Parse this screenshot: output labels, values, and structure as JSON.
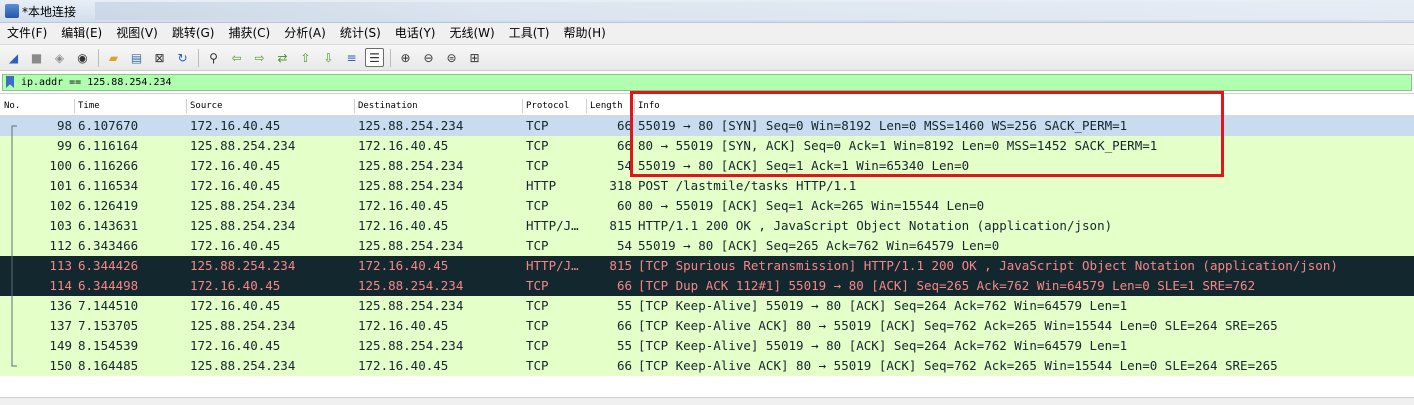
{
  "window": {
    "title": "*本地连接"
  },
  "menu": [
    "文件(F)",
    "编辑(E)",
    "视图(V)",
    "跳转(G)",
    "捕获(C)",
    "分析(A)",
    "统计(S)",
    "电话(Y)",
    "无线(W)",
    "工具(T)",
    "帮助(H)"
  ],
  "toolbar": {
    "buttons": [
      {
        "icon": "shark-fin-start-icon",
        "glyph": "◢",
        "color": "#2b5fb8"
      },
      {
        "icon": "stop-capture-icon",
        "glyph": "■",
        "color": "#8a8a8a"
      },
      {
        "icon": "restart-capture-icon",
        "glyph": "◈",
        "color": "#8a8a8a"
      },
      {
        "icon": "capture-options-icon",
        "glyph": "◉",
        "color": "#333333"
      },
      {
        "sep": true
      },
      {
        "icon": "open-file-icon",
        "glyph": "▰",
        "color": "#d7a52b"
      },
      {
        "icon": "save-file-icon",
        "glyph": "▤",
        "color": "#3a6ea5"
      },
      {
        "icon": "close-file-icon",
        "glyph": "⊠",
        "color": "#333333"
      },
      {
        "icon": "reload-file-icon",
        "glyph": "↻",
        "color": "#2b5fb8"
      },
      {
        "sep": true
      },
      {
        "icon": "find-packet-icon",
        "glyph": "⚲",
        "color": "#333333"
      },
      {
        "icon": "go-back-icon",
        "glyph": "⇦",
        "color": "#4e9a2a"
      },
      {
        "icon": "go-forward-icon",
        "glyph": "⇨",
        "color": "#4e9a2a"
      },
      {
        "icon": "go-to-packet-icon",
        "glyph": "⇄",
        "color": "#4e9a2a"
      },
      {
        "icon": "first-packet-icon",
        "glyph": "⇧",
        "color": "#4e9a2a"
      },
      {
        "icon": "last-packet-icon",
        "glyph": "⇩",
        "color": "#4e9a2a"
      },
      {
        "icon": "auto-scroll-icon",
        "glyph": "≡",
        "color": "#2b5fb8"
      },
      {
        "icon": "colorize-icon",
        "glyph": "☰",
        "color": "#333333",
        "selected": true
      },
      {
        "sep": true
      },
      {
        "icon": "zoom-in-icon",
        "glyph": "⊕",
        "color": "#333333"
      },
      {
        "icon": "zoom-out-icon",
        "glyph": "⊖",
        "color": "#333333"
      },
      {
        "icon": "normal-size-icon",
        "glyph": "⊜",
        "color": "#333333"
      },
      {
        "icon": "resize-columns-icon",
        "glyph": "⊞",
        "color": "#333333"
      }
    ]
  },
  "filter": {
    "value": "ip.addr == 125.88.254.234"
  },
  "columns": {
    "no": "No.",
    "time": "Time",
    "source": "Source",
    "destination": "Destination",
    "protocol": "Protocol",
    "length": "Length",
    "info": "Info"
  },
  "packets": [
    {
      "no": "98",
      "time": "6.107670",
      "source": "172.16.40.45",
      "destination": "125.88.254.234",
      "protocol": "TCP",
      "length": "66",
      "info": "55019 → 80 [SYN] Seq=0 Win=8192 Len=0 MSS=1460 WS=256 SACK_PERM=1",
      "style": "selected"
    },
    {
      "no": "99",
      "time": "6.116164",
      "source": "125.88.254.234",
      "destination": "172.16.40.45",
      "protocol": "TCP",
      "length": "66",
      "info": "80 → 55019 [SYN, ACK] Seq=0 Ack=1 Win=8192 Len=0 MSS=1452 SACK_PERM=1",
      "style": "normal"
    },
    {
      "no": "100",
      "time": "6.116266",
      "source": "172.16.40.45",
      "destination": "125.88.254.234",
      "protocol": "TCP",
      "length": "54",
      "info": "55019 → 80 [ACK] Seq=1 Ack=1 Win=65340 Len=0",
      "style": "normal"
    },
    {
      "no": "101",
      "time": "6.116534",
      "source": "172.16.40.45",
      "destination": "125.88.254.234",
      "protocol": "HTTP",
      "length": "318",
      "info": "POST /lastmile/tasks HTTP/1.1",
      "style": "normal"
    },
    {
      "no": "102",
      "time": "6.126419",
      "source": "125.88.254.234",
      "destination": "172.16.40.45",
      "protocol": "TCP",
      "length": "60",
      "info": "80 → 55019 [ACK] Seq=1 Ack=265 Win=15544 Len=0",
      "style": "normal"
    },
    {
      "no": "103",
      "time": "6.143631",
      "source": "125.88.254.234",
      "destination": "172.16.40.45",
      "protocol": "HTTP/J…",
      "length": "815",
      "info": "HTTP/1.1 200 OK , JavaScript Object Notation (application/json)",
      "style": "normal"
    },
    {
      "no": "112",
      "time": "6.343466",
      "source": "172.16.40.45",
      "destination": "125.88.254.234",
      "protocol": "TCP",
      "length": "54",
      "info": "55019 → 80 [ACK] Seq=265 Ack=762 Win=64579 Len=0",
      "style": "normal"
    },
    {
      "no": "113",
      "time": "6.344426",
      "source": "125.88.254.234",
      "destination": "172.16.40.45",
      "protocol": "HTTP/J…",
      "length": "815",
      "info": "[TCP Spurious Retransmission] HTTP/1.1 200 OK , JavaScript Object Notation (application/json)",
      "style": "bad"
    },
    {
      "no": "114",
      "time": "6.344498",
      "source": "172.16.40.45",
      "destination": "125.88.254.234",
      "protocol": "TCP",
      "length": "66",
      "info": "[TCP Dup ACK 112#1] 55019 → 80 [ACK] Seq=265 Ack=762 Win=64579 Len=0 SLE=1 SRE=762",
      "style": "bad"
    },
    {
      "no": "136",
      "time": "7.144510",
      "source": "172.16.40.45",
      "destination": "125.88.254.234",
      "protocol": "TCP",
      "length": "55",
      "info": "[TCP Keep-Alive] 55019 → 80 [ACK] Seq=264 Ack=762 Win=64579 Len=1",
      "style": "normal"
    },
    {
      "no": "137",
      "time": "7.153705",
      "source": "125.88.254.234",
      "destination": "172.16.40.45",
      "protocol": "TCP",
      "length": "66",
      "info": "[TCP Keep-Alive ACK] 80 → 55019 [ACK] Seq=762 Ack=265 Win=15544 Len=0 SLE=264 SRE=265",
      "style": "normal"
    },
    {
      "no": "149",
      "time": "8.154539",
      "source": "172.16.40.45",
      "destination": "125.88.254.234",
      "protocol": "TCP",
      "length": "55",
      "info": "[TCP Keep-Alive] 55019 → 80 [ACK] Seq=264 Ack=762 Win=64579 Len=1",
      "style": "normal"
    },
    {
      "no": "150",
      "time": "8.164485",
      "source": "125.88.254.234",
      "destination": "172.16.40.45",
      "protocol": "TCP",
      "length": "66",
      "info": "[TCP Keep-Alive ACK] 80 → 55019 [ACK] Seq=762 Ack=265 Win=15544 Len=0 SLE=264 SRE=265",
      "style": "normal"
    }
  ],
  "annotation": {
    "color": "#e3141c"
  }
}
